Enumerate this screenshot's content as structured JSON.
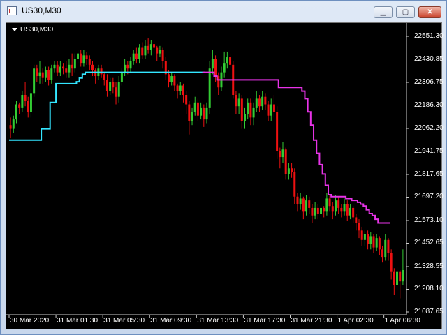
{
  "window": {
    "title": "US30,M30",
    "icon": "chart-icon"
  },
  "controls": {
    "minimize": "minimize-icon",
    "maximize": "maximize-icon",
    "close": "close-icon"
  },
  "chart_label": "US30,M30",
  "colors": {
    "background": "#000000",
    "bull": "#33cc33",
    "bear": "#ee1111",
    "line_up": "#33e6ff",
    "line_down": "#e833e8",
    "text": "#ffffff"
  },
  "chart_data": {
    "type": "candlestick",
    "symbol": "US30",
    "timeframe": "M30",
    "y_ticks": [
      "22551.30",
      "22430.85",
      "22306.75",
      "22186.30",
      "22062.20",
      "21941.75",
      "21817.65",
      "21697.20",
      "21573.10",
      "21452.65",
      "21328.55",
      "21208.10",
      "21087.65"
    ],
    "y_tick_values": [
      22551.3,
      22430.85,
      22306.75,
      22186.3,
      22062.2,
      21941.75,
      21817.65,
      21697.2,
      21573.1,
      21452.65,
      21328.55,
      21208.1,
      21087.65
    ],
    "ylim": [
      21070,
      22590
    ],
    "x_ticks": [
      "30 Mar 2020",
      "31 Mar 01:30",
      "31 Mar 05:30",
      "31 Mar 09:30",
      "31 Mar 13:30",
      "31 Mar 17:30",
      "31 Mar 21:30",
      "1 Apr 02:30",
      "1 Apr 06:30"
    ],
    "x_tick_index": [
      0,
      16,
      32,
      48,
      64,
      80,
      96,
      112,
      128
    ],
    "candles": [
      [
        22080,
        22060,
        22120,
        22010
      ],
      [
        22060,
        22110,
        22130,
        22040
      ],
      [
        22110,
        22190,
        22210,
        22090
      ],
      [
        22190,
        22170,
        22200,
        22140
      ],
      [
        22170,
        22240,
        22260,
        22150
      ],
      [
        22240,
        22210,
        22310,
        22180
      ],
      [
        22210,
        22150,
        22230,
        22120
      ],
      [
        22150,
        22250,
        22270,
        22120
      ],
      [
        22250,
        22380,
        22400,
        22230
      ],
      [
        22380,
        22340,
        22400,
        22310
      ],
      [
        22340,
        22360,
        22420,
        22300
      ],
      [
        22360,
        22330,
        22380,
        22300
      ],
      [
        22330,
        22370,
        22390,
        22310
      ],
      [
        22370,
        22320,
        22390,
        22290
      ],
      [
        22320,
        22380,
        22400,
        22300
      ],
      [
        22380,
        22400,
        22420,
        22360
      ],
      [
        22400,
        22360,
        22420,
        22340
      ],
      [
        22360,
        22390,
        22420,
        22340
      ],
      [
        22390,
        22380,
        22410,
        22350
      ],
      [
        22380,
        22360,
        22420,
        22330
      ],
      [
        22360,
        22400,
        22430,
        22330
      ],
      [
        22400,
        22380,
        22460,
        22340
      ],
      [
        22380,
        22430,
        22460,
        22360
      ],
      [
        22430,
        22460,
        22480,
        22410
      ],
      [
        22460,
        22410,
        22480,
        22390
      ],
      [
        22410,
        22450,
        22480,
        22390
      ],
      [
        22450,
        22430,
        22470,
        22400
      ],
      [
        22430,
        22400,
        22450,
        22370
      ],
      [
        22400,
        22370,
        22420,
        22340
      ],
      [
        22370,
        22340,
        22380,
        22300
      ],
      [
        22340,
        22380,
        22400,
        22320
      ],
      [
        22380,
        22350,
        22400,
        22330
      ],
      [
        22350,
        22320,
        22360,
        22290
      ],
      [
        22320,
        22260,
        22350,
        22230
      ],
      [
        22260,
        22310,
        22330,
        22240
      ],
      [
        22310,
        22280,
        22330,
        22250
      ],
      [
        22280,
        22230,
        22310,
        22190
      ],
      [
        22230,
        22310,
        22340,
        22200
      ],
      [
        22310,
        22360,
        22380,
        22290
      ],
      [
        22360,
        22400,
        22430,
        22340
      ],
      [
        22400,
        22380,
        22420,
        22350
      ],
      [
        22380,
        22420,
        22440,
        22360
      ],
      [
        22420,
        22460,
        22480,
        22400
      ],
      [
        22460,
        22430,
        22490,
        22410
      ],
      [
        22430,
        22490,
        22510,
        22410
      ],
      [
        22490,
        22450,
        22520,
        22430
      ],
      [
        22450,
        22500,
        22530,
        22430
      ],
      [
        22500,
        22480,
        22540,
        22460
      ],
      [
        22480,
        22510,
        22530,
        22450
      ],
      [
        22510,
        22490,
        22530,
        22460
      ],
      [
        22490,
        22460,
        22500,
        22420
      ],
      [
        22460,
        22480,
        22500,
        22440
      ],
      [
        22480,
        22420,
        22490,
        22380
      ],
      [
        22420,
        22350,
        22440,
        22320
      ],
      [
        22350,
        22310,
        22370,
        22280
      ],
      [
        22310,
        22340,
        22360,
        22290
      ],
      [
        22340,
        22290,
        22350,
        22260
      ],
      [
        22290,
        22260,
        22300,
        22220
      ],
      [
        22260,
        22290,
        22310,
        22240
      ],
      [
        22290,
        22240,
        22300,
        22200
      ],
      [
        22240,
        22190,
        22260,
        22140
      ],
      [
        22190,
        22100,
        22210,
        22030
      ],
      [
        22100,
        22150,
        22170,
        22080
      ],
      [
        22150,
        22200,
        22230,
        22130
      ],
      [
        22200,
        22130,
        22220,
        22100
      ],
      [
        22130,
        22170,
        22200,
        22110
      ],
      [
        22170,
        22110,
        22190,
        22070
      ],
      [
        22110,
        22170,
        22200,
        22090
      ],
      [
        22170,
        22380,
        22420,
        22140
      ],
      [
        22380,
        22430,
        22480,
        22350
      ],
      [
        22430,
        22340,
        22450,
        22310
      ],
      [
        22340,
        22280,
        22360,
        22240
      ],
      [
        22280,
        22360,
        22390,
        22260
      ],
      [
        22360,
        22410,
        22470,
        22330
      ],
      [
        22410,
        22440,
        22470,
        22380
      ],
      [
        22440,
        22400,
        22460,
        22370
      ],
      [
        22400,
        22240,
        22420,
        22220
      ],
      [
        22240,
        22180,
        22260,
        22140
      ],
      [
        22180,
        22220,
        22250,
        22140
      ],
      [
        22220,
        22100,
        22240,
        22060
      ],
      [
        22100,
        22140,
        22170,
        22060
      ],
      [
        22140,
        22200,
        22220,
        22110
      ],
      [
        22200,
        22120,
        22220,
        22080
      ],
      [
        22120,
        22170,
        22200,
        22080
      ],
      [
        22170,
        22220,
        22260,
        22150
      ],
      [
        22220,
        22180,
        22240,
        22150
      ],
      [
        22180,
        22230,
        22260,
        22160
      ],
      [
        22230,
        22190,
        22250,
        22160
      ],
      [
        22190,
        22130,
        22210,
        22100
      ],
      [
        22130,
        22190,
        22220,
        22100
      ],
      [
        22190,
        22150,
        22240,
        22120
      ],
      [
        22150,
        21940,
        22180,
        21900
      ],
      [
        21940,
        21910,
        21960,
        21850
      ],
      [
        21910,
        21950,
        21990,
        21880
      ],
      [
        21950,
        21820,
        21960,
        21790
      ],
      [
        21820,
        21850,
        21880,
        21790
      ],
      [
        21850,
        21830,
        21880,
        21800
      ],
      [
        21830,
        21700,
        21850,
        21660
      ],
      [
        21700,
        21660,
        21720,
        21620
      ],
      [
        21660,
        21690,
        21720,
        21630
      ],
      [
        21690,
        21620,
        21700,
        21580
      ],
      [
        21620,
        21680,
        21710,
        21600
      ],
      [
        21680,
        21640,
        21700,
        21610
      ],
      [
        21640,
        21600,
        21660,
        21560
      ],
      [
        21600,
        21640,
        21670,
        21580
      ],
      [
        21640,
        21610,
        21660,
        21580
      ],
      [
        21610,
        21640,
        21660,
        21590
      ],
      [
        21640,
        21620,
        21650,
        21590
      ],
      [
        21620,
        21690,
        21720,
        21600
      ],
      [
        21690,
        21650,
        21710,
        21620
      ],
      [
        21650,
        21620,
        21670,
        21580
      ],
      [
        21620,
        21680,
        21710,
        21600
      ],
      [
        21680,
        21640,
        21700,
        21610
      ],
      [
        21640,
        21620,
        21660,
        21590
      ],
      [
        21620,
        21660,
        21690,
        21600
      ],
      [
        21660,
        21600,
        21680,
        21570
      ],
      [
        21600,
        21640,
        21660,
        21580
      ],
      [
        21640,
        21590,
        21650,
        21560
      ],
      [
        21590,
        21560,
        21610,
        21520
      ],
      [
        21560,
        21520,
        21580,
        21480
      ],
      [
        21520,
        21470,
        21540,
        21440
      ],
      [
        21470,
        21500,
        21520,
        21440
      ],
      [
        21500,
        21450,
        21520,
        21420
      ],
      [
        21450,
        21490,
        21510,
        21420
      ],
      [
        21490,
        21430,
        21500,
        21400
      ],
      [
        21430,
        21480,
        21500,
        21410
      ],
      [
        21480,
        21420,
        21490,
        21390
      ],
      [
        21420,
        21380,
        21440,
        21350
      ],
      [
        21380,
        21470,
        21500,
        21360
      ],
      [
        21470,
        21400,
        21480,
        21360
      ],
      [
        21400,
        21300,
        21420,
        21260
      ],
      [
        21300,
        21230,
        21320,
        21180
      ],
      [
        21230,
        21300,
        21330,
        21200
      ],
      [
        21300,
        21250,
        21310,
        21160
      ],
      [
        21250,
        21310,
        21420,
        21230
      ]
    ],
    "trend_line": [
      22000,
      22000,
      22000,
      22000,
      22000,
      22000,
      22000,
      22000,
      22000,
      22000,
      22000,
      22060,
      22060,
      22060,
      22200,
      22200,
      22300,
      22300,
      22300,
      22300,
      22300,
      22300,
      22300,
      22310,
      22330,
      22350,
      22360,
      22360,
      22360,
      22360,
      22360,
      22360,
      22360,
      22360,
      22360,
      22360,
      22360,
      22360,
      22360,
      22360,
      22360,
      22360,
      22360,
      22360,
      22360,
      22360,
      22360,
      22360,
      22360,
      22360,
      22360,
      22360,
      22360,
      22360,
      22360,
      22360,
      22360,
      22360,
      22360,
      22360,
      22360,
      22360,
      22360,
      22360,
      22360,
      22360,
      22360,
      22360,
      22360,
      22360,
      22340,
      22320,
      22320,
      22320,
      22320,
      22320,
      22320,
      22320,
      22320,
      22320,
      22320,
      22320,
      22320,
      22320,
      22320,
      22320,
      22320,
      22320,
      22320,
      22320,
      22320,
      22320,
      22280,
      22280,
      22280,
      22280,
      22280,
      22280,
      22280,
      22280,
      22260,
      22220,
      22150,
      22080,
      22000,
      21930,
      21870,
      21820,
      21760,
      21710,
      21700,
      21700,
      21700,
      21700,
      21700,
      21690,
      21690,
      21680,
      21680,
      21670,
      21660,
      21650,
      21630,
      21610,
      21600,
      21580,
      21560,
      21560,
      21560,
      21560
    ],
    "trend_down_from_index": 66,
    "grid": false
  }
}
